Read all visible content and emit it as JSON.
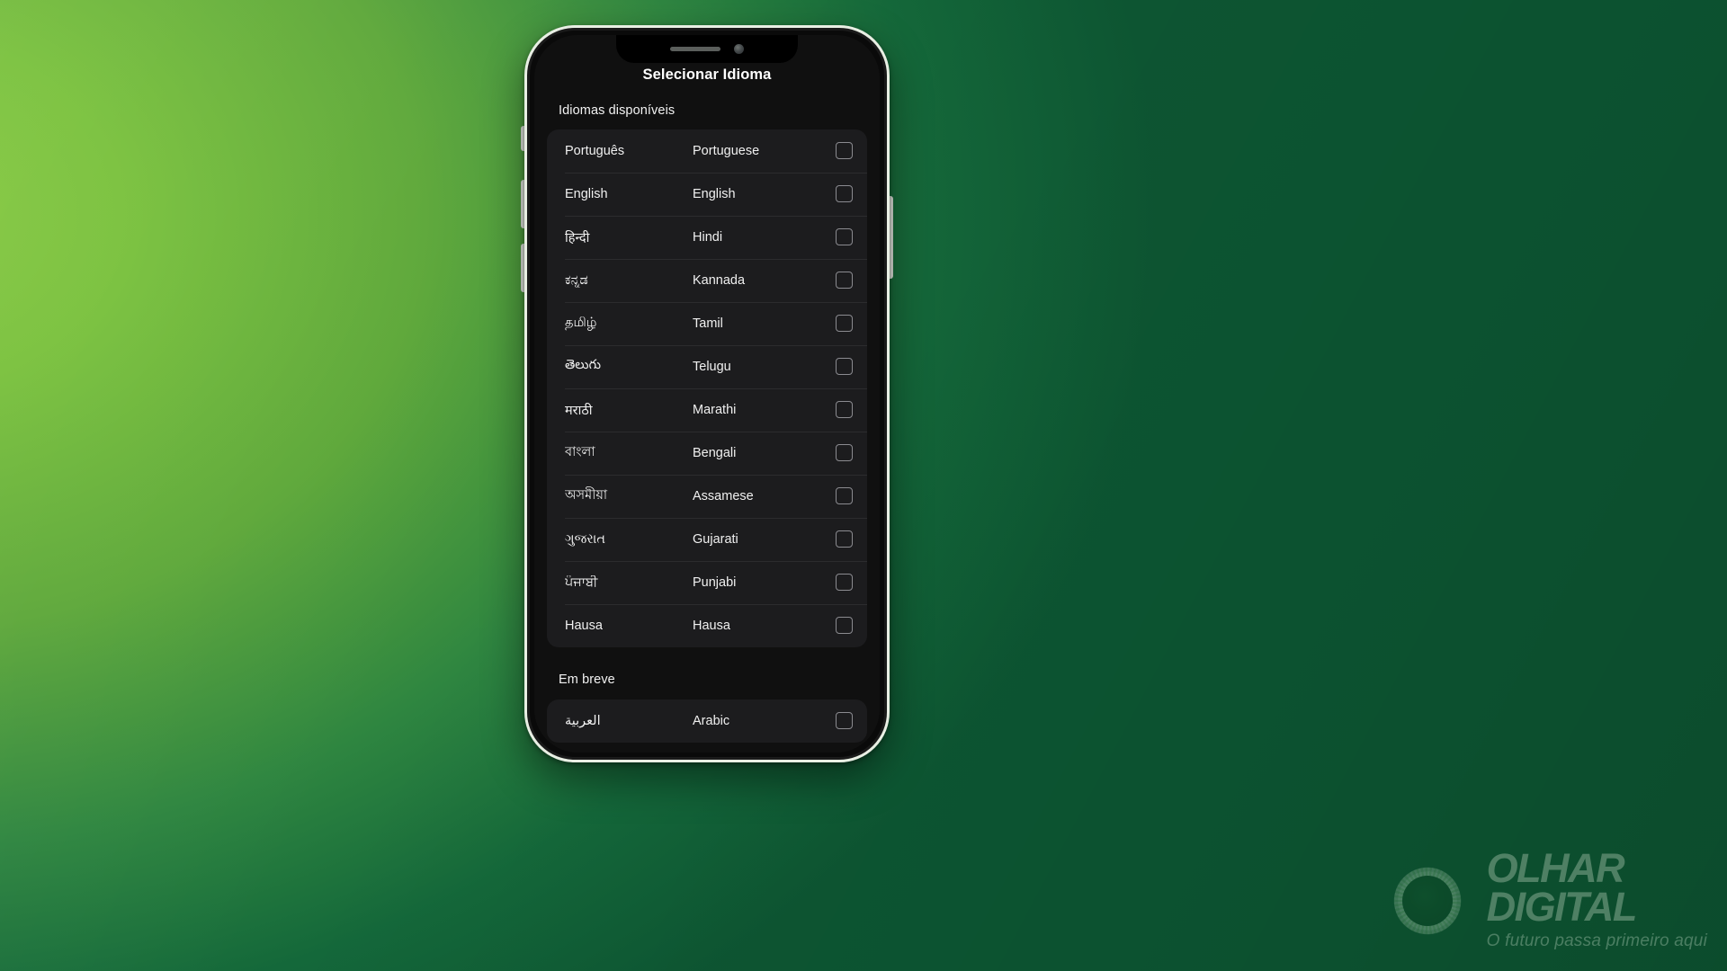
{
  "background": {
    "gradient_from": "#8ccb43",
    "gradient_to": "#0c5230"
  },
  "phone": {
    "notch": {
      "speaker_icon": "speaker-grille-icon",
      "camera_icon": "front-camera-icon"
    },
    "buttons": {
      "silent_switch": "silent-switch",
      "volume_up": "volume-up-button",
      "volume_down": "volume-down-button",
      "power": "power-button"
    }
  },
  "app": {
    "nav_title": "Selecionar Idioma",
    "sections": [
      {
        "id": "available",
        "header": "Idiomas disponíveis",
        "languages": [
          {
            "native": "Português",
            "english": "Portuguese",
            "checked": false
          },
          {
            "native": "English",
            "english": "English",
            "checked": false
          },
          {
            "native": "हिन्दी",
            "english": "Hindi",
            "checked": false
          },
          {
            "native": "ಕನ್ನಡ",
            "english": "Kannada",
            "checked": false
          },
          {
            "native": "தமிழ்",
            "english": "Tamil",
            "checked": false
          },
          {
            "native": "తెలుగు",
            "english": "Telugu",
            "checked": false
          },
          {
            "native": "मराठी",
            "english": "Marathi",
            "checked": false
          },
          {
            "native": "বাংলা",
            "english": "Bengali",
            "checked": false
          },
          {
            "native": "অসমীয়া",
            "english": "Assamese",
            "checked": false
          },
          {
            "native": "ગુજરાત",
            "english": "Gujarati",
            "checked": false
          },
          {
            "native": "ਪੰਜਾਬੀ",
            "english": "Punjabi",
            "checked": false
          },
          {
            "native": "Hausa",
            "english": "Hausa",
            "checked": false
          }
        ]
      },
      {
        "id": "soon",
        "header": "Em breve",
        "languages": [
          {
            "native": "العربية",
            "english": "Arabic",
            "checked": false
          }
        ]
      }
    ]
  },
  "watermark": {
    "line1": "OLHAR",
    "line2": "DIGITAL",
    "tagline": "O futuro passa primeiro aqui",
    "eye_icon": "eye-logo-icon"
  }
}
